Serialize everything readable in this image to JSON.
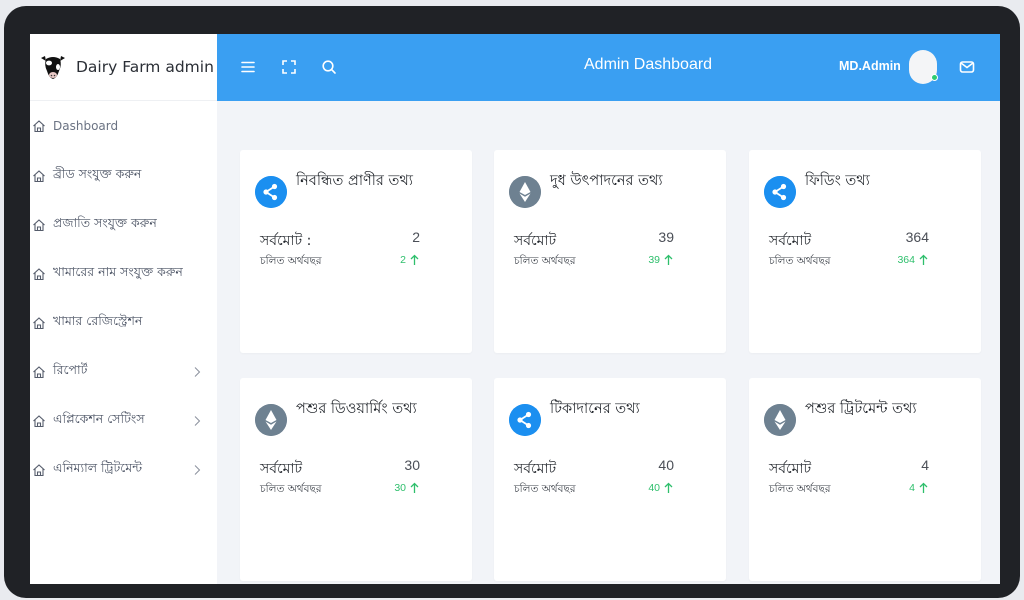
{
  "brand": {
    "name": "Dairy Farm admin",
    "icon": "cow-icon"
  },
  "sidebar": {
    "items": [
      {
        "label": "Dashboard",
        "icon": "home-icon",
        "active": true,
        "has_submenu": false
      },
      {
        "label": "ব্রীড সংযুক্ত করুন",
        "icon": "home-icon",
        "has_submenu": false
      },
      {
        "label": "প্রজাতি সংযুক্ত করুন",
        "icon": "home-icon",
        "has_submenu": false
      },
      {
        "label": "খামারের নাম সংযুক্ত করুন",
        "icon": "home-icon",
        "has_submenu": false
      },
      {
        "label": "খামার রেজিস্ট্রেশন",
        "icon": "home-icon",
        "has_submenu": false
      },
      {
        "label": "রিপোর্ট",
        "icon": "home-icon",
        "has_submenu": true
      },
      {
        "label": "এপ্লিকেশন সেটিংস",
        "icon": "home-icon",
        "has_submenu": true
      },
      {
        "label": "এনিম্যাল ট্রিটমেন্ট",
        "icon": "home-icon",
        "has_submenu": true
      }
    ]
  },
  "topbar": {
    "title": "Admin Dashboard",
    "user_name": "MD.Admin",
    "icons": [
      "menu-icon",
      "fullscreen-icon",
      "search-icon",
      "mail-icon"
    ],
    "online_status_color": "#2ecc71"
  },
  "cards": [
    {
      "title": "নিবন্ধিত প্রাণীর তথ্য",
      "icon": "ripple-icon",
      "icon_color": "#1b8ff0",
      "total_label": "সর্বমোট :",
      "total_value": "2",
      "fy_label": "চলিত অর্থবছর",
      "change": "2"
    },
    {
      "title": "দুধ উৎপাদনের তথ্য",
      "icon": "ethereum-icon",
      "icon_color": "#6e8191",
      "total_label": "সর্বমোট",
      "total_value": "39",
      "fy_label": "চলিত অর্থবছর",
      "change": "39"
    },
    {
      "title": "ফিডিং তথ্য",
      "icon": "ripple-icon",
      "icon_color": "#1b8ff0",
      "total_label": "সর্বমোট",
      "total_value": "364",
      "fy_label": "চলিত অর্থবছর",
      "change": "364"
    },
    {
      "title": "পশুর ডিওয়ার্মিং তথ্য",
      "icon": "ethereum-icon",
      "icon_color": "#6e8191",
      "total_label": "সর্বমোট",
      "total_value": "30",
      "fy_label": "চলিত অর্থবছর",
      "change": "30"
    },
    {
      "title": "টিকাদানের তথ্য",
      "icon": "ripple-icon",
      "icon_color": "#1b8ff0",
      "total_label": "সর্বমোট",
      "total_value": "40",
      "fy_label": "চলিত অর্থবছর",
      "change": "40"
    },
    {
      "title": "পশুর ট্রিটমেন্ট তথ্য",
      "icon": "ethereum-icon",
      "icon_color": "#6e8191",
      "total_label": "সর্বমোট",
      "total_value": "4",
      "fy_label": "চলিত অর্থবছর",
      "change": "4"
    }
  ],
  "colors": {
    "topbar": "#3a9ff2",
    "positive_change": "#2ebf6c",
    "frame": "#202226"
  }
}
